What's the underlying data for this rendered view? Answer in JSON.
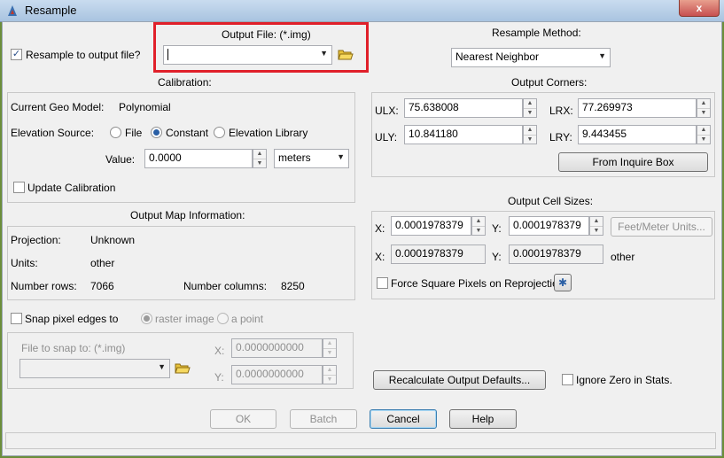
{
  "window": {
    "title": "Resample",
    "close_glyph": "x"
  },
  "output_file": {
    "label": "Output File: (*.img)",
    "value": "",
    "folder_icon": "folder-open-icon",
    "highlight_color": "#e0202a"
  },
  "resample_to_output": {
    "label": "Resample to output file?",
    "checked": true
  },
  "resample_method": {
    "label": "Resample Method:",
    "value": "Nearest Neighbor"
  },
  "calibration": {
    "heading": "Calibration:",
    "geo_model_label": "Current Geo Model:",
    "geo_model_value": "Polynomial",
    "elevation_label": "Elevation Source:",
    "options": [
      "File",
      "Constant",
      "Elevation Library"
    ],
    "selected": "Constant",
    "value_label": "Value:",
    "value": "0.0000",
    "unit": "meters",
    "update_label": "Update Calibration"
  },
  "output_corners": {
    "heading": "Output Corners:",
    "ulx_label": "ULX:",
    "ulx": "75.638008",
    "lrx_label": "LRX:",
    "lrx": "77.269973",
    "uly_label": "ULY:",
    "uly": "10.841180",
    "lry_label": "LRY:",
    "lry": "9.443455",
    "inquire_button": "From Inquire Box"
  },
  "map_info": {
    "heading": "Output Map Information:",
    "projection_label": "Projection:",
    "projection": "Unknown",
    "units_label": "Units:",
    "units": "other",
    "rows_label": "Number rows:",
    "rows": "7066",
    "cols_label": "Number columns:",
    "cols": "8250"
  },
  "cell_sizes": {
    "heading": "Output Cell Sizes:",
    "x_label": "X:",
    "x": "0.0001978379",
    "y_label": "Y:",
    "y": "0.0001978379",
    "units_button": "Feet/Meter Units...",
    "x2": "0.0001978379",
    "y2": "0.0001978379",
    "unit_text": "other",
    "force_square_label": "Force Square Pixels on Reprojection",
    "star_icon": "asterisk-icon"
  },
  "snap": {
    "label": "Snap pixel edges to",
    "raster_label": "raster image",
    "point_label": "a point",
    "file_label": "File to snap to: (*.img)",
    "x_label": "X:",
    "x": "0.0000000000",
    "y_label": "Y:",
    "y": "0.0000000000"
  },
  "recalculate_button": "Recalculate Output Defaults...",
  "ignore_zero_label": "Ignore Zero in Stats.",
  "buttons": {
    "ok": "OK",
    "batch": "Batch",
    "cancel": "Cancel",
    "help": "Help"
  }
}
